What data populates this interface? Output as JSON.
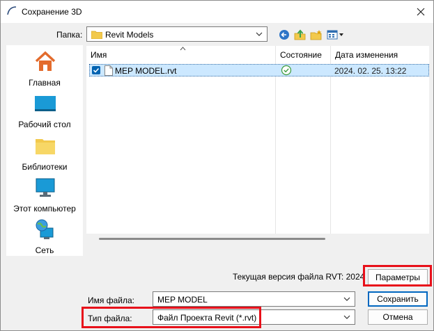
{
  "window": {
    "title": "Сохранение 3D"
  },
  "folder": {
    "label": "Папка:",
    "value": "Revit Models"
  },
  "toolbar": {
    "back_icon": "back-arrow-icon",
    "up_icon": "up-folder-icon",
    "new_folder_icon": "new-folder-icon",
    "views_icon": "views-menu-icon"
  },
  "places": [
    {
      "label": "Главная",
      "icon": "home-icon"
    },
    {
      "label": "Рабочий стол",
      "icon": "desktop-icon"
    },
    {
      "label": "Библиотеки",
      "icon": "libraries-icon"
    },
    {
      "label": "Этот компьютер",
      "icon": "computer-icon"
    },
    {
      "label": "Сеть",
      "icon": "network-icon"
    }
  ],
  "file_list": {
    "columns": [
      "Имя",
      "Состояние",
      "Дата изменения"
    ],
    "rows": [
      {
        "name": "MEP MODEL.rvt",
        "state": "synced",
        "date": "2024. 02. 25. 13:22",
        "selected": true
      }
    ]
  },
  "version_text": "Текущая версия файла RVT: 2024",
  "buttons": {
    "options": "Параметры",
    "save": "Сохранить",
    "cancel": "Отмена"
  },
  "filename": {
    "label": "Имя файла:",
    "value": "MEP MODEL"
  },
  "filetype": {
    "label": "Тип файла:",
    "value": "Файл Проекта Revit (*.rvt)"
  },
  "colors": {
    "accent": "#0067c0",
    "highlight": "#e8101a",
    "selection": "#cce8ff",
    "folder": "#f2c94c"
  }
}
